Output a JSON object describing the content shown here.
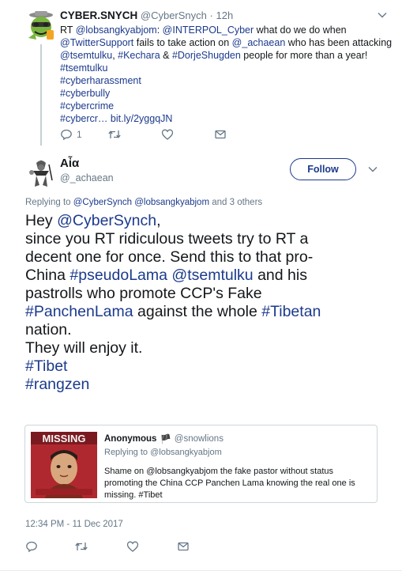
{
  "parent_tweet": {
    "author_name": "CYBER.SNYCH",
    "author_handle": "@CyberSnych",
    "separator": "·",
    "age": "12h",
    "body": {
      "l1_a": "RT ",
      "l1_b": "@lobsangkyabjom",
      "l1_c": ": ",
      "l1_d": "@INTERPOL_Cyber",
      "l1_e": " what do we do when",
      "l2_a": "@TwitterSupport",
      "l2_b": " fails to take action on ",
      "l2_c": "@_achaean",
      "l2_d": " who has been attacking",
      "l3_a": "@tsemtulku",
      "l3_b": ", ",
      "l3_c": "#Kechara",
      "l3_d": " & ",
      "l3_e": "#DorjeShugden",
      "l3_f": " people for more than a year!",
      "l4": "#tsemtulku",
      "l5": "#cyberharassment",
      "l6": "#cyberbully",
      "l7": "#cybercrime",
      "l8_a": "#cybercr…",
      "l8_b": " bit.ly/2yggqJN"
    },
    "reply_count": "1",
    "icons": {
      "reply": "reply-icon",
      "retweet": "retweet-icon",
      "like": "heart-icon",
      "message": "envelope-icon",
      "more": "chevron-down-icon"
    }
  },
  "main_tweet": {
    "author_name": "Aἶα",
    "author_handle": "@_achaean",
    "follow_label": "Follow",
    "replying": {
      "prefix": "Replying to ",
      "user1": "@CyberSynch",
      "space": " ",
      "user2": "@lobsangkyabjom",
      "suffix": " and 3 others"
    },
    "text": {
      "l1_a": "Hey ",
      "l1_b": "@CyberSynch",
      "l1_c": ",",
      "l2": "since you RT ridiculous tweets try to RT a",
      "l3": "decent one for once. Send this to that pro-",
      "l4_a": "China ",
      "l4_b": "#pseudoLama",
      "l4_c": " ",
      "l4_d": "@tsemtulku",
      "l4_e": " and his",
      "l5": "pastrolls who promote CCP's Fake",
      "l6_a": "#PanchenLama",
      "l6_b": " against the whole ",
      "l6_c": "#Tibetan",
      "l7": "nation.",
      "l8": "They will enjoy it.",
      "l9": "#Tibet",
      "l10": "#rangzen"
    },
    "quoted": {
      "author_name": "Anonymous",
      "flag_glyph": "🏴",
      "author_handle": "@snowlions",
      "replying_to": "Replying to @lobsangkyabjom",
      "l1": "Shame on @lobsangkyabjom the fake pastor without status",
      "l2": "promoting the China CCP Panchen Lama knowing the real one is",
      "l3": "missing. #Tibet",
      "image_caption": "MISSING"
    },
    "timestamp": "12:34 PM - 11 Dec 2017",
    "icons": {
      "reply": "reply-icon",
      "retweet": "retweet-icon",
      "like": "heart-icon",
      "message": "envelope-icon",
      "more": "chevron-down-icon"
    }
  },
  "colors": {
    "link": "#1b3a8c",
    "muted": "#657786",
    "text": "#14171a",
    "border": "#ccd6dd"
  }
}
